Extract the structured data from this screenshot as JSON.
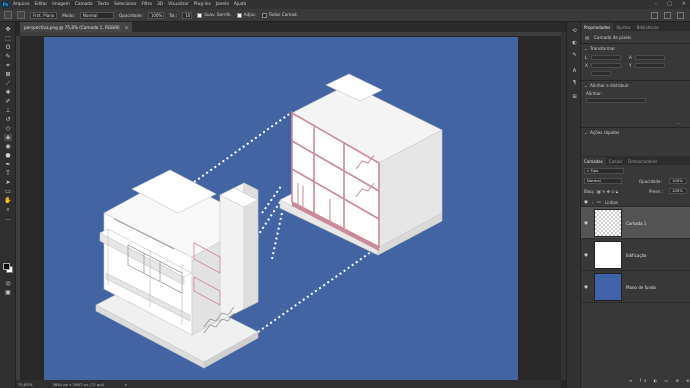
{
  "app": {
    "logo": "Ps",
    "menu": [
      "Arquivo",
      "Editar",
      "Imagem",
      "Camada",
      "Texto",
      "Selecionar",
      "Filtro",
      "3D",
      "Visualizar",
      "Plug-ins",
      "Janela",
      "Ajuda"
    ]
  },
  "options": {
    "tool_preset": "Frnt. Plano",
    "mode_label": "Modo:",
    "mode_value": "Normal",
    "opacity_label": "Opacidade:",
    "opacity_value": "100%",
    "tolerance_label": "Tol.:",
    "tolerance_value": "10",
    "anti_alias": "Suav. Serrilh.",
    "contiguous": "Adjac.",
    "all_layers": "Todas Camad."
  },
  "document": {
    "tab_title": "perspectiva.png @ 75,8% (Camada 1, RGB/8)",
    "tab_close": "×"
  },
  "status": {
    "zoom": "75,85%",
    "doc_info": "3884 px x 2667 px (72 ppi)",
    "arrow": ">"
  },
  "properties": {
    "tabs": [
      "Propriedades",
      "Ajustes",
      "Bibliotecas"
    ],
    "layer_kind": "Camada de pixels",
    "transform_title": "Transformar",
    "w_label": "L",
    "h_label": "A",
    "x_label": "X",
    "y_label": "Y",
    "align_title": "Alinhar e distribuir",
    "align_sub": "Alinhar:",
    "quick_actions": "Ações rápidas"
  },
  "layers": {
    "tabs": [
      "Camadas",
      "Canais",
      "Demarcadores"
    ],
    "filter_kind": "Tipo",
    "blend_mode": "Normal",
    "opacity_label": "Opacidade:",
    "opacity_value": "100%",
    "lock_label": "Bloq.:",
    "fill_label": "Preen.:",
    "fill_value": "100%",
    "group_name": "Linhas",
    "items": [
      {
        "name": "Camada 1",
        "thumb": "transparent",
        "selected": true
      },
      {
        "name": "Edificação",
        "thumb": "white",
        "selected": false
      },
      {
        "name": "Plano de fundo",
        "thumb": "#3f63a8",
        "selected": false
      }
    ]
  },
  "colors": {
    "canvas_bg": "#4264a3",
    "section_pink": "#c98a99",
    "ps_blue": "#31a8ff"
  }
}
